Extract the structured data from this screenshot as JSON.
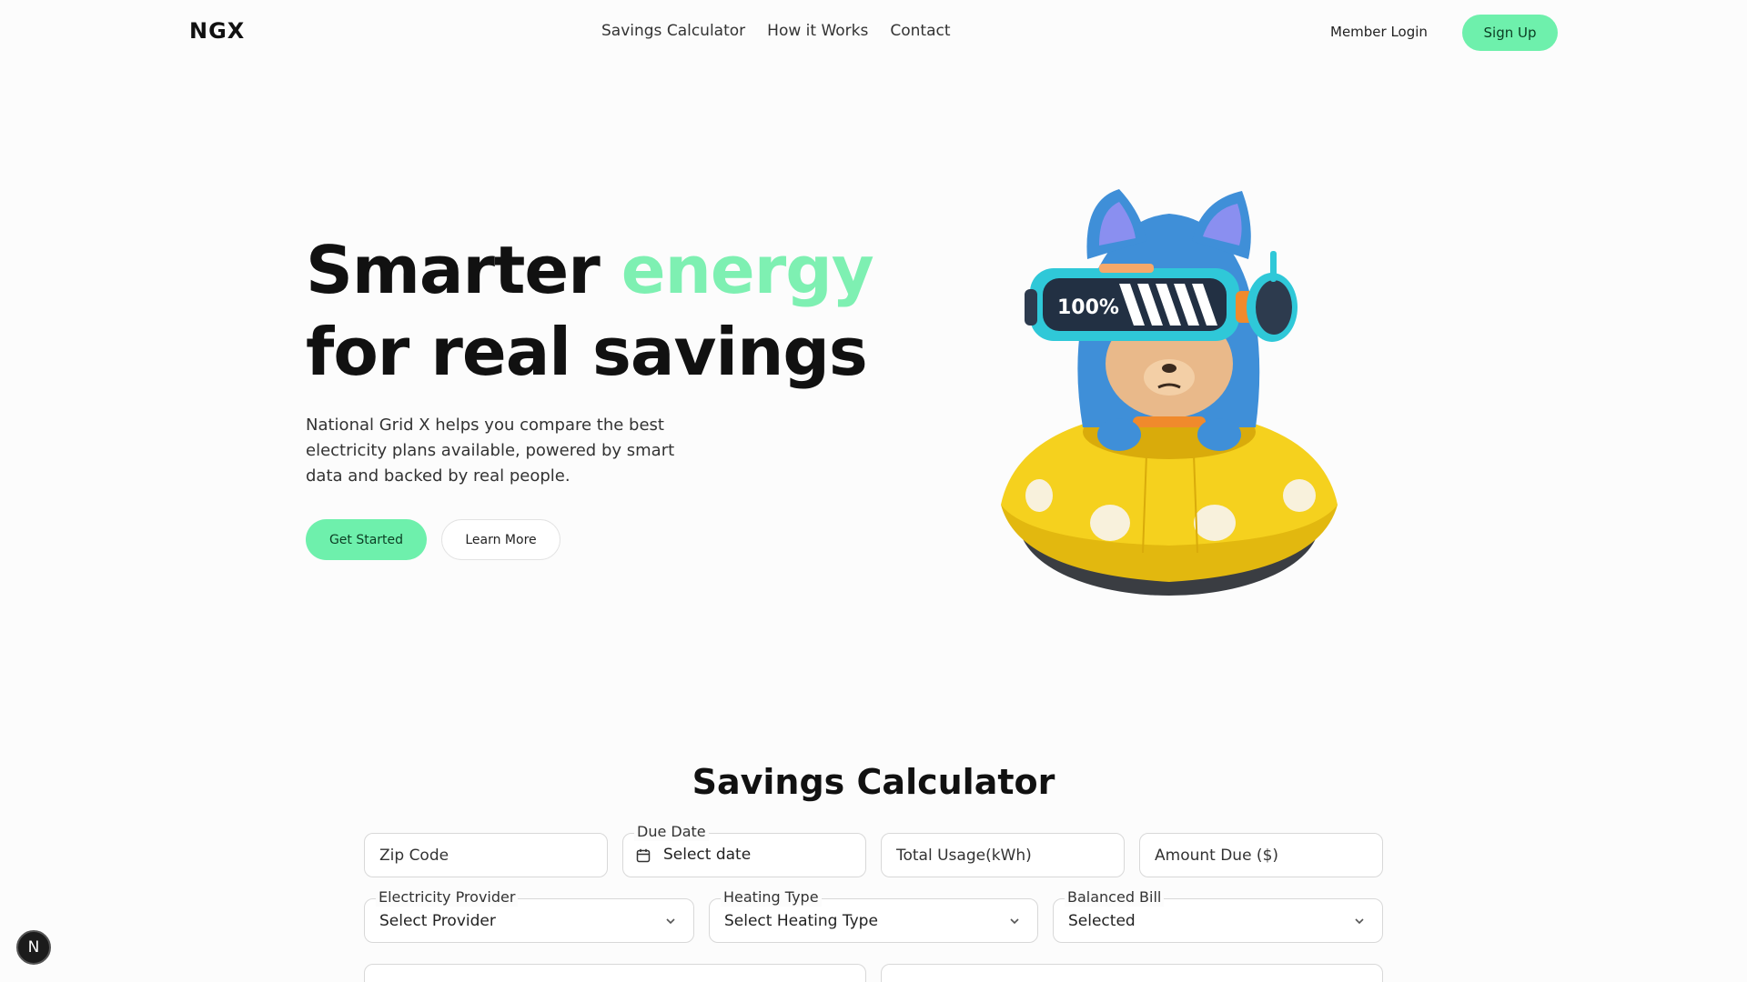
{
  "nav": {
    "logo": "NGX",
    "links": [
      "Savings Calculator",
      "How it Works",
      "Contact"
    ],
    "member_login": "Member Login",
    "sign_up": "Sign Up"
  },
  "hero": {
    "title_line1_pre": "Smarter ",
    "title_line1_accent": "energy",
    "title_line2": "for real savings",
    "description": "National Grid X helps you compare the best electricity plans available, powered by smart data and backed by real people.",
    "primary_button": "Get Started",
    "secondary_button": "Learn More",
    "visor_text": "100%"
  },
  "calculator": {
    "title": "Savings Calculator",
    "zip_code_placeholder": "Zip Code",
    "due_date_label": "Due Date",
    "due_date_value": "Select date",
    "total_usage_placeholder": "Total Usage(kWh)",
    "amount_due_placeholder": "Amount Due ($)",
    "provider_label": "Electricity Provider",
    "provider_value": "Select Provider",
    "heating_label": "Heating Type",
    "heating_value": "Select Heating Type",
    "balanced_label": "Balanced Bill",
    "balanced_value": "Selected"
  },
  "badge": {
    "letter": "N"
  },
  "colors": {
    "accent": "#6ef0ac",
    "accent_text": "#7ef0b2"
  }
}
